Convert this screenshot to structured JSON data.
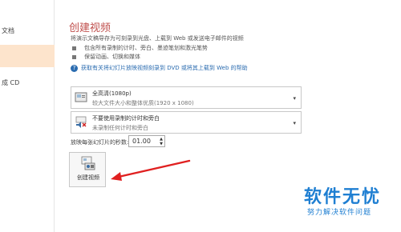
{
  "nav": {
    "items": [
      {
        "label": "文档"
      },
      {
        "label": ""
      },
      {
        "label": "成 CD"
      }
    ]
  },
  "main": {
    "title": "创建视频",
    "subtitle": "将演示文稿导存为可刻录到光盘、上载到 Web 或发送电子邮件的视频",
    "bullets": [
      "包含所有录制的计时、旁白、墨迹笔划和激光笔势",
      "保留动画、切换和媒体"
    ],
    "help_link": "获取有关将幻灯片放映视频刻录到 DVD 或将其上载到 Web 的帮助"
  },
  "quality_select": {
    "line1": "全高清(1080p)",
    "line2": "较大文件大小和整体优质(1920 x 1080)"
  },
  "timing_select": {
    "line1": "不要使用录制的计时和旁白",
    "line2": "未录制任何计时和旁白"
  },
  "seconds": {
    "label": "放映每张幻灯片的秒数:",
    "value": "01.00"
  },
  "create_button": {
    "label": "创建视频"
  },
  "watermark": {
    "line1": "软件无忧",
    "line2": "努力解决软件问题"
  },
  "icons": {
    "help": "help-icon",
    "quality": "video-quality-icon",
    "timing": "speaker-muted-icon",
    "create": "create-video-icon"
  },
  "colors": {
    "title": "#c0504d",
    "nav_selected": "#fde4cc",
    "link": "#2b6cb0",
    "arrow": "#e02020",
    "watermark": "#1f7fd2"
  }
}
